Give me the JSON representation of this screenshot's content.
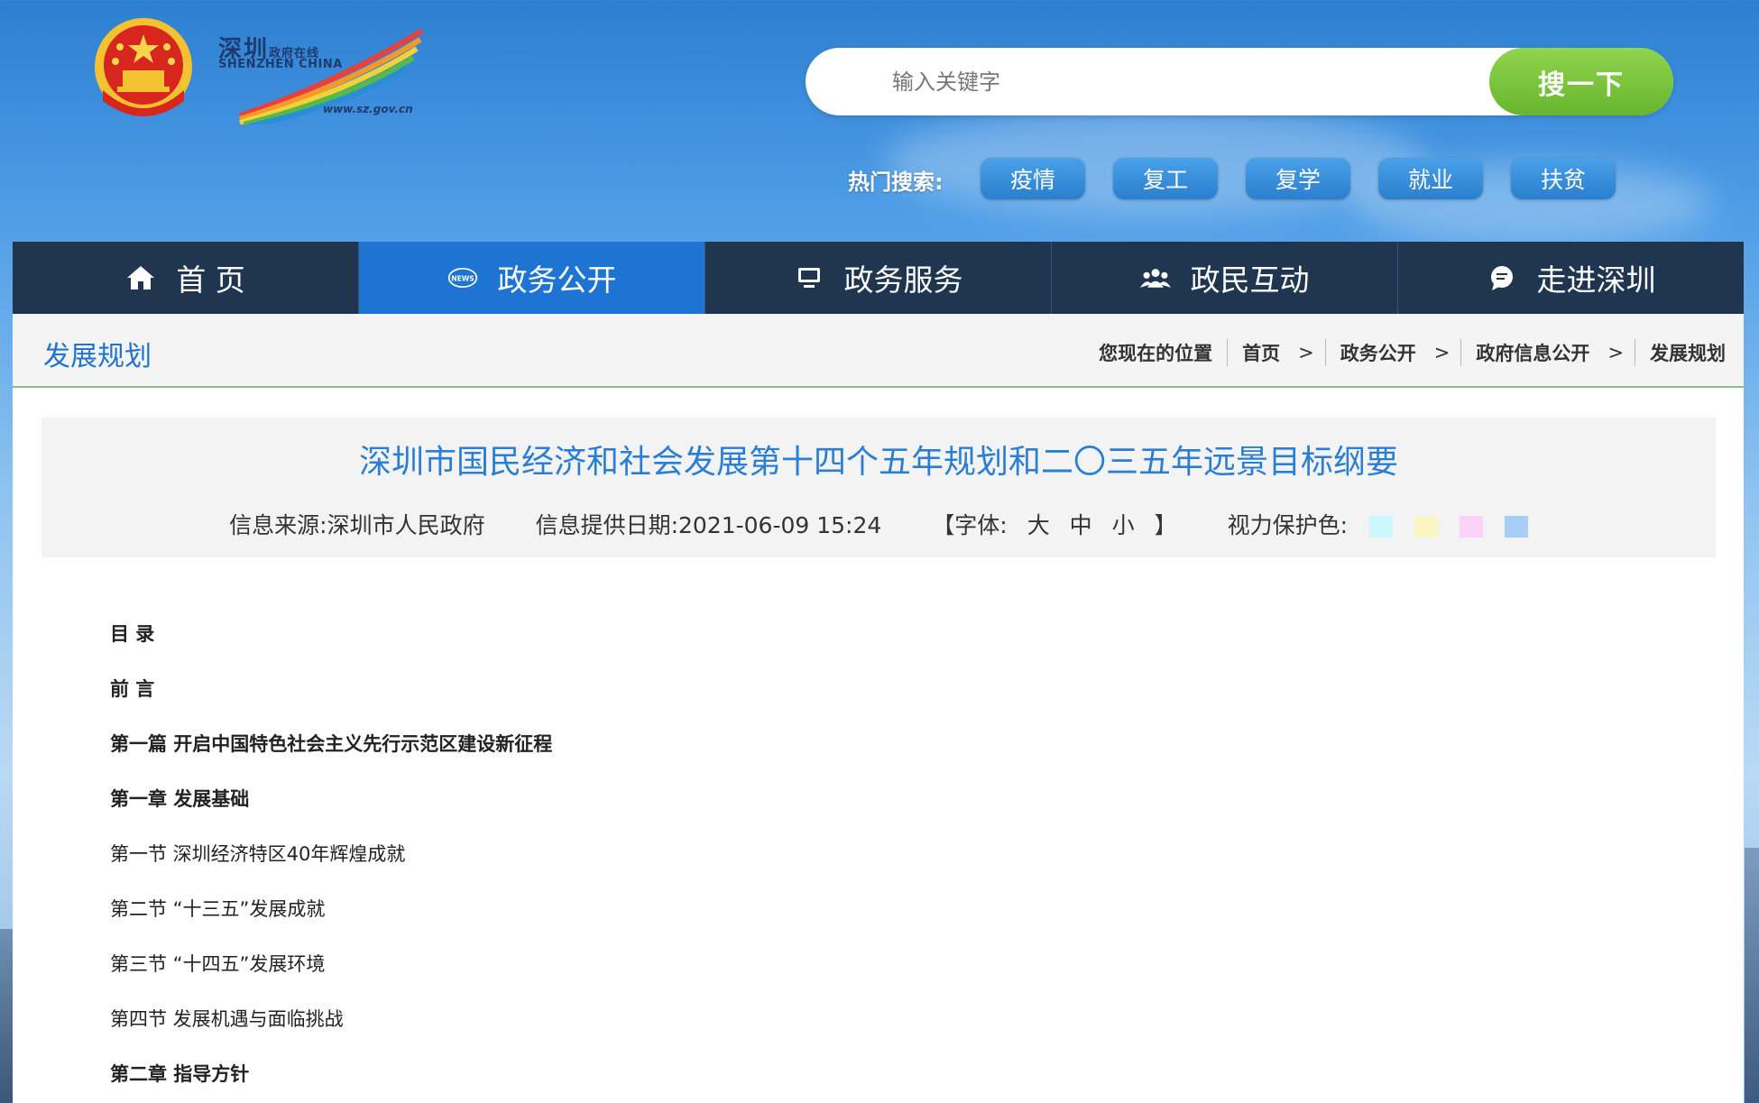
{
  "header": {
    "logo": {
      "cn": "深圳",
      "cn_small": "政府在线",
      "en": "SHENZHEN CHINA",
      "url": "www.sz.gov.cn"
    },
    "search": {
      "placeholder": "输入关键字",
      "button": "搜一下"
    },
    "hot": {
      "label": "热门搜索:",
      "tags": [
        "疫情",
        "复工",
        "复学",
        "就业",
        "扶贫"
      ]
    }
  },
  "nav": {
    "items": [
      {
        "label": "首 页",
        "icon": "home-icon"
      },
      {
        "label": "政务公开",
        "icon": "news-icon"
      },
      {
        "label": "政务服务",
        "icon": "monitor-icon"
      },
      {
        "label": "政民互动",
        "icon": "people-icon"
      },
      {
        "label": "走进深圳",
        "icon": "chat-icon"
      }
    ],
    "active_index": 1
  },
  "crumbbar": {
    "section": "发展规划",
    "location_label": "您现在的位置",
    "crumbs": [
      "首页",
      "政务公开",
      "政府信息公开",
      "发展规划"
    ]
  },
  "article": {
    "title": "深圳市国民经济和社会发展第十四个五年规划和二〇三五年远景目标纲要",
    "source": "信息来源:深圳市人民政府",
    "date": "信息提供日期:2021-06-09 15:24",
    "font_open": "【字体:",
    "font_sizes": [
      "大",
      "中",
      "小"
    ],
    "font_close": "】",
    "eye_label": "视力保护色:",
    "eye_colors": [
      "#ccf7fb",
      "#faf6c4",
      "#fbd2f8",
      "#a9cef5"
    ]
  },
  "toc": [
    {
      "text": "目  录",
      "bold": true
    },
    {
      "text": "前  言",
      "bold": true
    },
    {
      "text": "第一篇 开启中国特色社会主义先行示范区建设新征程",
      "bold": true
    },
    {
      "text": "第一章 发展基础",
      "bold": true
    },
    {
      "text": "第一节 深圳经济特区40年辉煌成就",
      "bold": false
    },
    {
      "text": "第二节 “十三五”发展成就",
      "bold": false
    },
    {
      "text": "第三节 “十四五”发展环境",
      "bold": false
    },
    {
      "text": "第四节 发展机遇与面临挑战",
      "bold": false
    },
    {
      "text": "第二章 指导方针",
      "bold": true
    }
  ]
}
